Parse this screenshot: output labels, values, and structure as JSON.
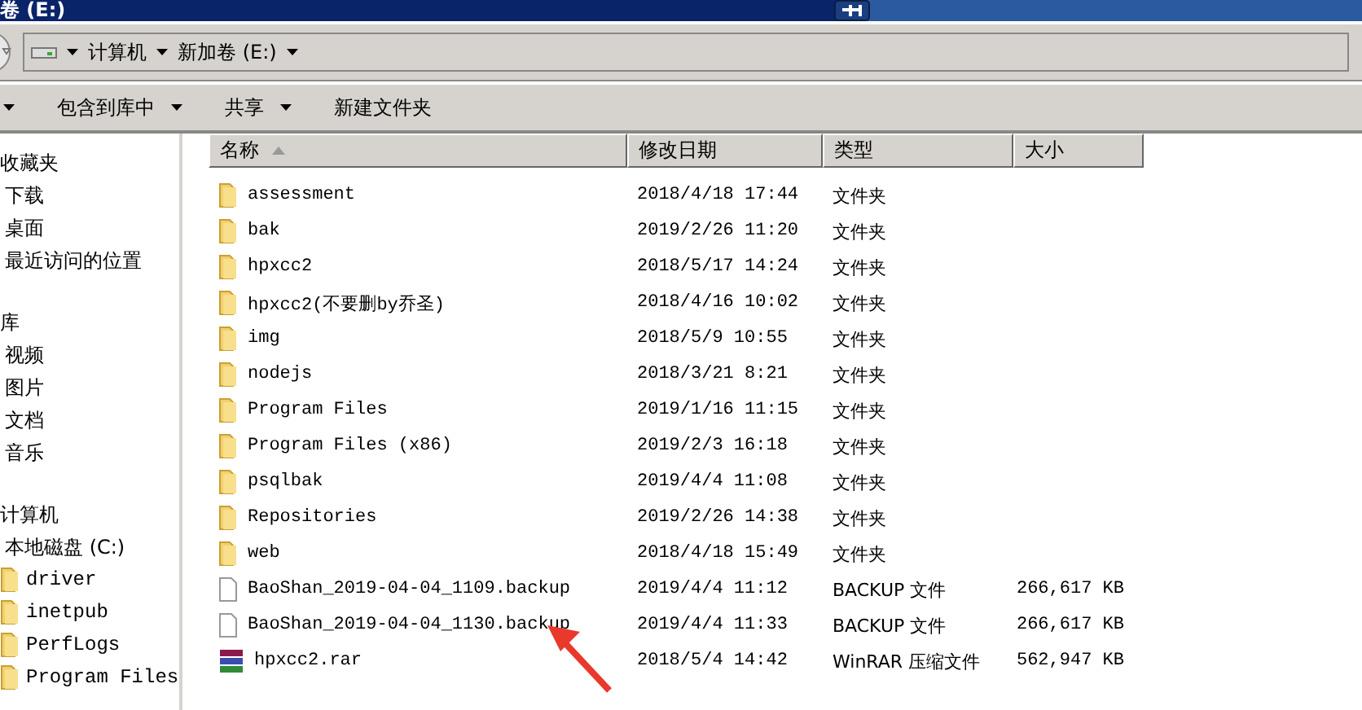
{
  "window": {
    "title": "卷 (E:)"
  },
  "address_bar": {
    "segments": [
      "计算机",
      "新加卷 (E:)"
    ]
  },
  "toolbar": {
    "items": [
      {
        "dropdown": true
      },
      {
        "label": "包含到库中",
        "dropdown": true
      },
      {
        "label": "共享",
        "dropdown": true
      },
      {
        "label": "新建文件夹",
        "dropdown": false
      }
    ]
  },
  "sidebar": {
    "groups": [
      {
        "label": "收藏夹",
        "children": [
          {
            "label": "下载",
            "kind": "plain"
          },
          {
            "label": "桌面",
            "kind": "plain"
          },
          {
            "label": "最近访问的位置",
            "kind": "plain"
          }
        ]
      },
      {
        "label": "库",
        "children": [
          {
            "label": "视频",
            "kind": "plain"
          },
          {
            "label": "图片",
            "kind": "plain"
          },
          {
            "label": "文档",
            "kind": "plain"
          },
          {
            "label": "音乐",
            "kind": "plain"
          }
        ]
      },
      {
        "label": "计算机",
        "children": [
          {
            "label": "本地磁盘 (C:)",
            "kind": "plain"
          },
          {
            "label": "driver",
            "kind": "folder"
          },
          {
            "label": "inetpub",
            "kind": "folder"
          },
          {
            "label": "PerfLogs",
            "kind": "folder"
          },
          {
            "label": "Program Files",
            "kind": "folder"
          }
        ]
      }
    ]
  },
  "table": {
    "columns": [
      {
        "label": "名称",
        "sorted": true
      },
      {
        "label": "修改日期",
        "sorted": false
      },
      {
        "label": "类型",
        "sorted": false
      },
      {
        "label": "大小",
        "sorted": false
      }
    ],
    "rows": [
      {
        "kind": "folder",
        "name": "assessment",
        "date": "2018/4/18 17:44",
        "type": "文件夹"
      },
      {
        "kind": "folder",
        "name": "bak",
        "date": "2019/2/26 11:20",
        "type": "文件夹"
      },
      {
        "kind": "folder",
        "name": "hpxcc2",
        "date": "2018/5/17 14:24",
        "type": "文件夹"
      },
      {
        "kind": "folder",
        "name": "hpxcc2(不要删by乔圣)",
        "date": "2018/4/16 10:02",
        "type": "文件夹"
      },
      {
        "kind": "folder",
        "name": "img",
        "date": "2018/5/9 10:55",
        "type": "文件夹"
      },
      {
        "kind": "folder",
        "name": "nodejs",
        "date": "2018/3/21 8:21",
        "type": "文件夹"
      },
      {
        "kind": "folder",
        "name": "Program Files",
        "date": "2019/1/16 11:15",
        "type": "文件夹"
      },
      {
        "kind": "folder",
        "name": "Program Files (x86)",
        "date": "2019/2/3 16:18",
        "type": "文件夹"
      },
      {
        "kind": "folder",
        "name": "psqlbak",
        "date": "2019/4/4 11:08",
        "type": "文件夹"
      },
      {
        "kind": "folder",
        "name": "Repositories",
        "date": "2019/2/26 14:38",
        "type": "文件夹"
      },
      {
        "kind": "folder",
        "name": "web",
        "date": "2018/4/18 15:49",
        "type": "文件夹"
      },
      {
        "kind": "file",
        "name": "BaoShan_2019-04-04_1109.backup",
        "date": "2019/4/4 11:12",
        "type": "BACKUP 文件",
        "size": "266,617 KB"
      },
      {
        "kind": "file",
        "name": "BaoShan_2019-04-04_1130.backup",
        "date": "2019/4/4 11:33",
        "type": "BACKUP 文件",
        "size": "266,617 KB"
      },
      {
        "kind": "archive",
        "name": "hpxcc2.rar",
        "date": "2018/5/4 14:42",
        "type": "WinRAR 压缩文件",
        "size": "562,947 KB"
      }
    ]
  }
}
